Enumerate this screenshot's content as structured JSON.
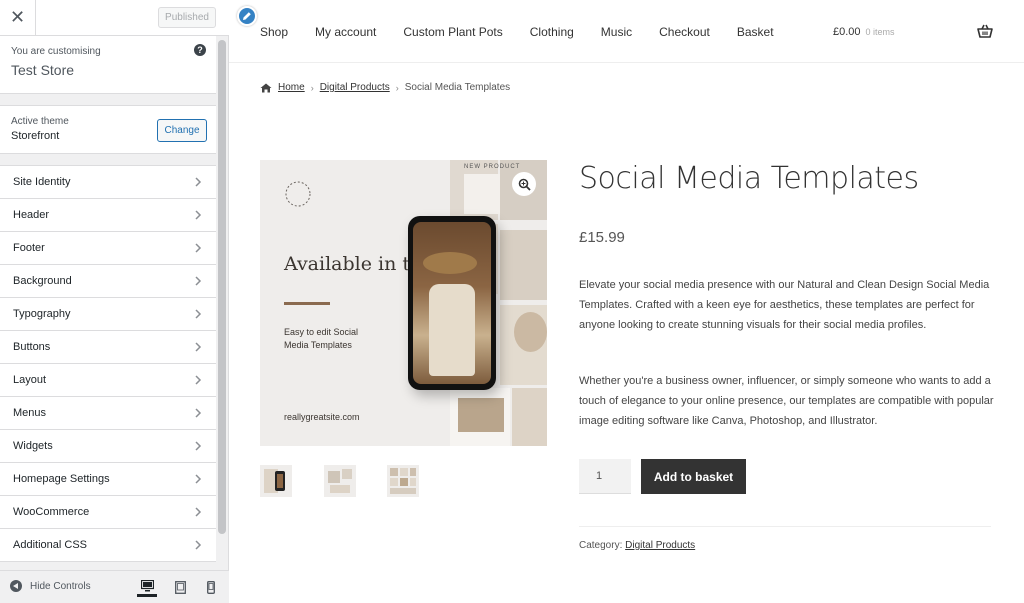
{
  "sidebar": {
    "close_icon": "close-icon",
    "published_label": "Published",
    "customising_label": "You are customising",
    "store_name": "Test Store",
    "active_theme_label": "Active theme",
    "theme_name": "Storefront",
    "change_label": "Change",
    "sections": [
      "Site Identity",
      "Header",
      "Footer",
      "Background",
      "Typography",
      "Buttons",
      "Layout",
      "Menus",
      "Widgets",
      "Homepage Settings",
      "WooCommerce",
      "Additional CSS"
    ],
    "hide_controls_label": "Hide Controls"
  },
  "preview": {
    "nav": [
      "Shop",
      "My account",
      "Custom Plant Pots",
      "Clothing",
      "Music",
      "Checkout",
      "Basket"
    ],
    "cart_amount": "£0.00",
    "cart_count": "0 items",
    "breadcrumb": {
      "home": "Home",
      "category": "Digital Products",
      "current": "Social Media Templates"
    },
    "image": {
      "headline": "Available in the Shop",
      "subtext": "Easy to edit Social Media Templates",
      "url": "reallygreatsite.com",
      "badge": "NEW PRODUCT"
    },
    "product": {
      "title": "Social Media Templates",
      "price": "£15.99",
      "description_1": "Elevate your social media presence with our Natural and Clean Design Social Media Templates. Crafted with a keen eye for aesthetics, these templates are perfect for anyone looking to create stunning visuals for their social media profiles.",
      "description_2": "Whether you're a business owner, influencer, or simply someone who wants to add a touch of elegance to your online presence, our templates are compatible with popular image editing software like Canva, Photoshop, and Illustrator.",
      "quantity": "1",
      "add_to_basket_label": "Add to basket",
      "category_label": "Category:",
      "category_value": "Digital Products"
    }
  },
  "colors": {
    "accent": "#2271b1",
    "button_dark": "#333333",
    "pencil": "#3582c4"
  }
}
